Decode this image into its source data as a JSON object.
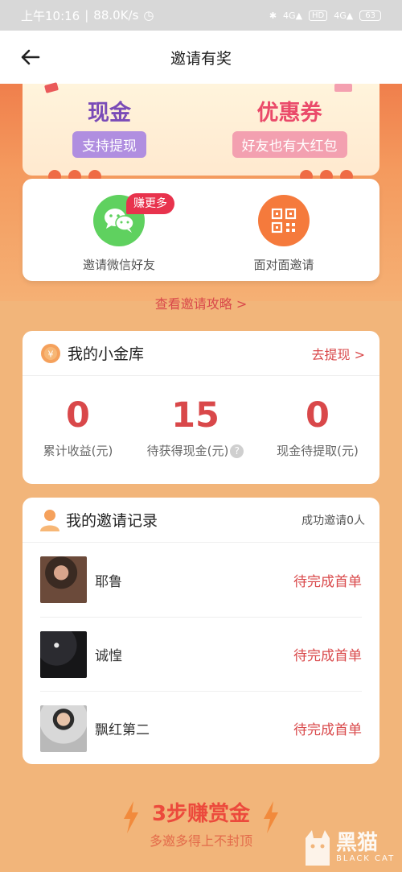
{
  "status_bar": {
    "time": "上午10:16",
    "speed": "88.0K/s",
    "signal1": "4G",
    "hd": "HD",
    "signal2": "4G",
    "battery": "63"
  },
  "header": {
    "title": "邀请有奖"
  },
  "rewards": {
    "cash": {
      "title": "现金",
      "tag": "支持提现"
    },
    "coupon": {
      "title": "优惠券",
      "tag": "好友也有大红包"
    }
  },
  "invite": {
    "wechat_label": "邀请微信好友",
    "badge": "赚更多",
    "qr_label": "面对面邀请"
  },
  "strategy_link": "查看邀请攻略 >",
  "vault": {
    "title": "我的小金库",
    "withdraw_link": "去提现 >",
    "stats": [
      {
        "value": "0",
        "label": "累计收益(元)"
      },
      {
        "value": "15",
        "label": "待获得现金(元)"
      },
      {
        "value": "0",
        "label": "现金待提取(元)"
      }
    ],
    "help_icon": "?"
  },
  "records": {
    "title": "我的邀请记录",
    "summary": "成功邀请0人",
    "items": [
      {
        "name": "耶鲁",
        "status": "待完成首单"
      },
      {
        "name": "诚惶",
        "status": "待完成首单"
      },
      {
        "name": "飘红第二",
        "status": "待完成首单"
      }
    ]
  },
  "footer": {
    "title": "3步赚赏金",
    "subtitle": "多邀多得上不封顶"
  },
  "watermark": {
    "big": "黑猫",
    "small": "BLACK CAT"
  },
  "colors": {
    "accent_red": "#d9484a",
    "wechat_green": "#5fd15f",
    "qr_orange": "#f57a3c",
    "page_bg": "#f2b57a"
  }
}
